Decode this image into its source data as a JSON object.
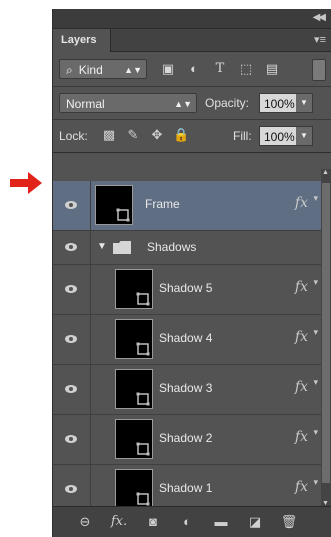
{
  "panel": {
    "tab_label": "Layers"
  },
  "filter": {
    "kind_label": "Kind"
  },
  "blend": {
    "mode": "Normal",
    "opacity_label": "Opacity:",
    "opacity_value": "100%",
    "lock_label": "Lock:",
    "fill_label": "Fill:",
    "fill_value": "100%"
  },
  "layers": {
    "frame": {
      "name": "Frame",
      "fx": "fx"
    },
    "group": {
      "name": "Shadows"
    },
    "items": [
      {
        "name": "Shadow 5",
        "fx": "fx"
      },
      {
        "name": "Shadow 4",
        "fx": "fx"
      },
      {
        "name": "Shadow 3",
        "fx": "fx"
      },
      {
        "name": "Shadow 2",
        "fx": "fx"
      },
      {
        "name": "Shadow 1",
        "fx": "fx"
      }
    ]
  },
  "bottom": {
    "fx_label": "fx."
  },
  "colors": {
    "arrow": "#e2231a",
    "panel_bg": "#535353",
    "selected_bg": "#5f6e83"
  }
}
